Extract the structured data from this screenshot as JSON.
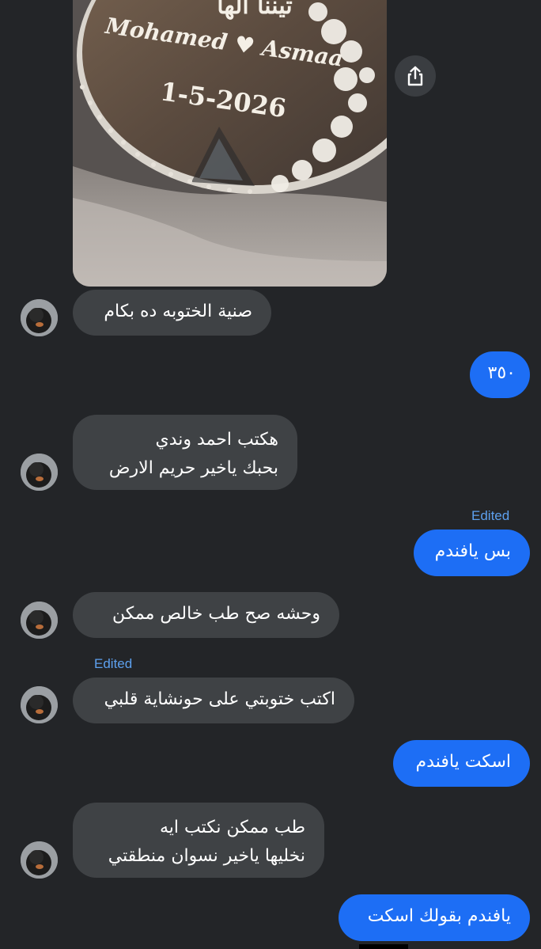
{
  "photo": {
    "names_text": "Mohamed ♥ Asmaa",
    "date_text": "1-5-2026",
    "arabic_text": "تيننا الها"
  },
  "share_icon": "share-icon",
  "colors": {
    "background": "#232528",
    "incoming_bubble": "#3f4245",
    "outgoing_bubble": "#1d6ef5",
    "edited_label": "#5da0ee"
  },
  "messages": [
    {
      "direction": "in",
      "lines": [
        "صنية الختوبه ده بكام"
      ]
    },
    {
      "direction": "out",
      "lines": [
        "٣٥٠"
      ]
    },
    {
      "direction": "in",
      "lines": [
        "هكتب احمد وندي",
        "بحبك ياخير حريم الارض"
      ]
    },
    {
      "direction": "out",
      "lines": [
        "بس يافندم"
      ],
      "edited": "Edited"
    },
    {
      "direction": "in",
      "lines": [
        "وحشه صح طب خالص ممكن"
      ]
    },
    {
      "direction": "in",
      "lines": [
        "اكتب ختوبتي على حونشاية قلبي"
      ],
      "edited": "Edited"
    },
    {
      "direction": "out",
      "lines": [
        "اسكت يافندم"
      ]
    },
    {
      "direction": "in",
      "lines": [
        "طب ممكن نكتب ايه",
        "نخليها ياخير نسوان منطقتي"
      ]
    },
    {
      "direction": "out",
      "lines": [
        "يافندم بقولك اسكت"
      ]
    }
  ]
}
